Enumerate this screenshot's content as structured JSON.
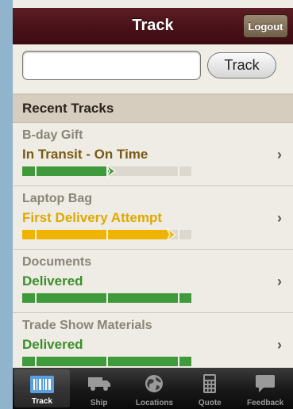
{
  "header": {
    "title": "Track",
    "logout_label": "Logout"
  },
  "search": {
    "value": "",
    "placeholder": "",
    "button_label": "Track"
  },
  "section": {
    "title": "Recent Tracks"
  },
  "tracks": [
    {
      "name": "B-day Gift",
      "status": "In Transit - On Time",
      "status_color": "#7a5a12",
      "progress": 0.52,
      "bar_color": "#3f9a3b",
      "arrow": true
    },
    {
      "name": "Laptop Bag",
      "status": "First Delivery Attempt",
      "status_color": "#e0a800",
      "progress": 0.88,
      "bar_color": "#f0b400",
      "arrow": true
    },
    {
      "name": "Documents",
      "status": "Delivered",
      "status_color": "#3b8f2a",
      "progress": 1.0,
      "bar_color": "#3f9a3b",
      "arrow": false
    },
    {
      "name": "Trade Show Materials",
      "status": "Delivered",
      "status_color": "#3b8f2a",
      "progress": 1.0,
      "bar_color": "#3f9a3b",
      "arrow": false
    }
  ],
  "tabs": [
    {
      "label": "Track",
      "icon": "barcode-icon",
      "active": true
    },
    {
      "label": "Ship",
      "icon": "truck-icon",
      "active": false
    },
    {
      "label": "Locations",
      "icon": "globe-icon",
      "active": false
    },
    {
      "label": "Quote",
      "icon": "calculator-icon",
      "active": false
    },
    {
      "label": "Feedback",
      "icon": "speech-bubble-icon",
      "active": false
    }
  ]
}
